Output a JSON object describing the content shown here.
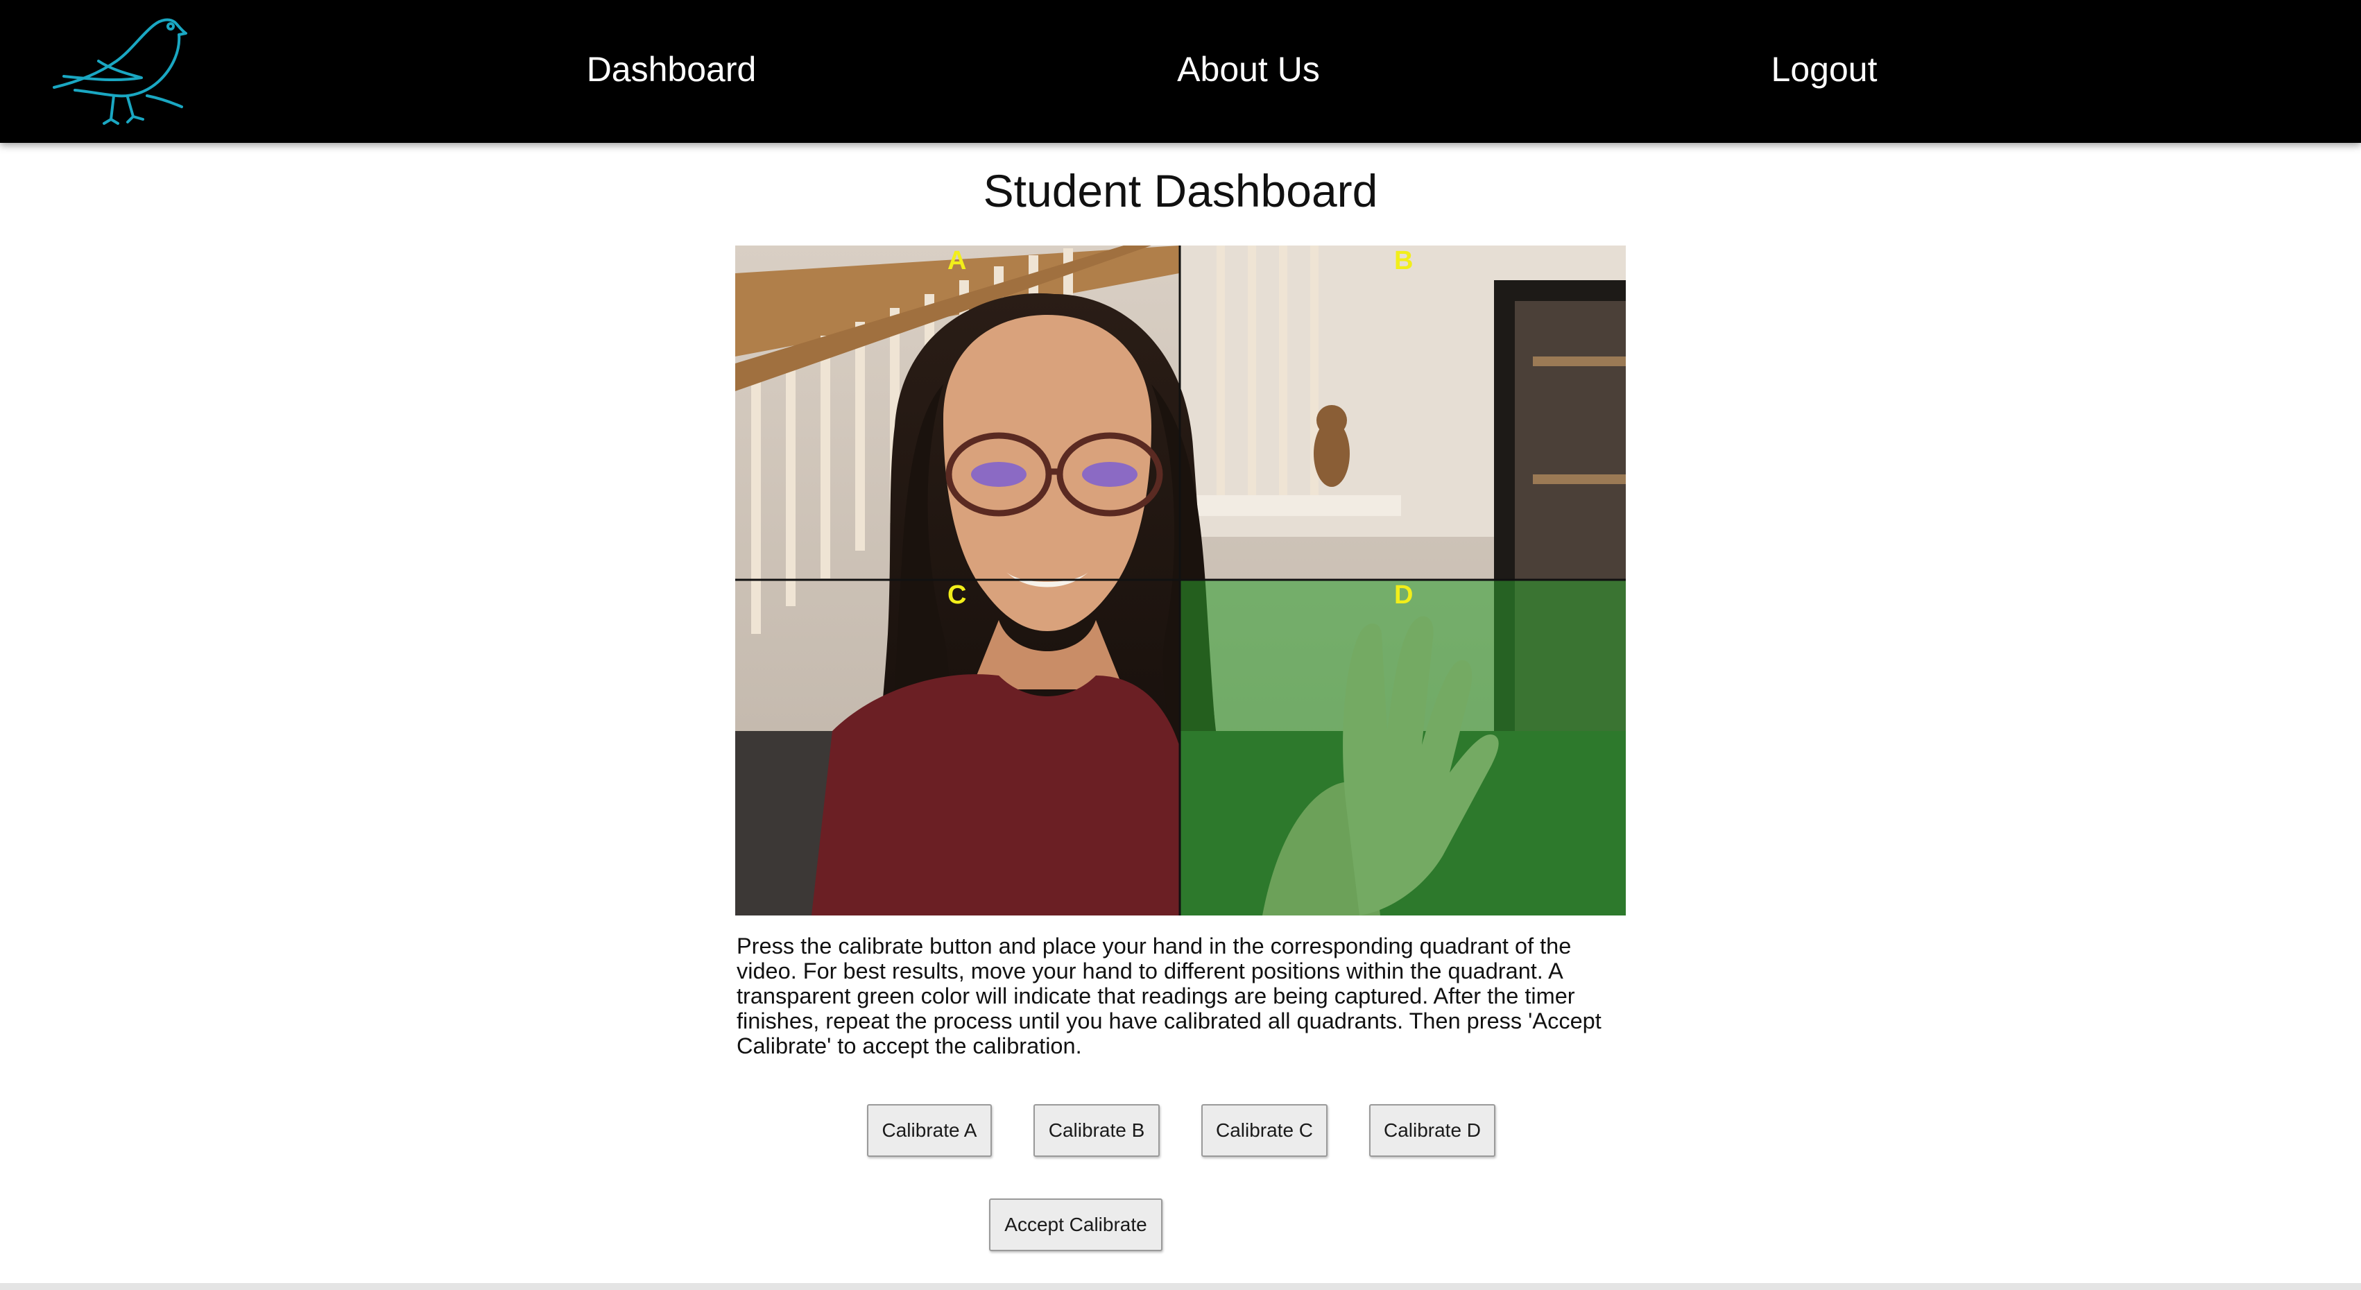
{
  "nav": {
    "logo_icon": "bird-icon",
    "logo_color": "#1aa7c2",
    "links": [
      "Dashboard",
      "About Us",
      "Logout"
    ]
  },
  "page": {
    "title": "Student Dashboard"
  },
  "video": {
    "quadrants": [
      "A",
      "B",
      "C",
      "D"
    ],
    "active_quadrant": "D",
    "highlight_color": "#2e9e2e"
  },
  "instructions": "Press the calibrate button and place your hand in the corresponding quadrant of the video. For best results, move your hand to different positions within the quadrant. A transparent green color will indicate that readings are being captured. After the timer finishes, repeat the process until you have calibrated all quadrants. Then press 'Accept Calibrate' to accept the calibration.",
  "buttons": {
    "calibrate_a": "Calibrate A",
    "calibrate_b": "Calibrate B",
    "calibrate_c": "Calibrate C",
    "calibrate_d": "Calibrate D",
    "accept": "Accept Calibrate"
  }
}
